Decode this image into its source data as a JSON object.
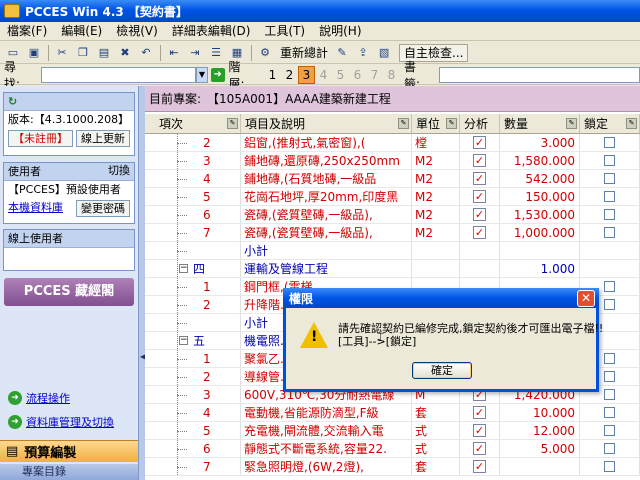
{
  "window": {
    "title": "PCCES Win 4.3 【契約書】"
  },
  "menu": [
    "檔案(F)",
    "編輯(E)",
    "檢視(V)",
    "詳細表編輯(D)",
    "工具(T)",
    "說明(H)"
  ],
  "toolbar": {
    "recalc": "重新總計",
    "selfcheck": "自主檢查..."
  },
  "search": {
    "label": "尋找:",
    "level_label": "階層:",
    "levels": [
      "1",
      "2",
      "3",
      "4",
      "5",
      "6",
      "7",
      "8"
    ],
    "active_level": "3",
    "bookmark_label": "書籤:"
  },
  "left": {
    "version": "版本:【4.3.1000.208】",
    "unregistered": "【未註冊】",
    "online_update": "線上更新",
    "user_header": "使用者",
    "switch": "切換",
    "default_user": "【PCCES】預設使用者",
    "local_db": "本機資料庫",
    "change_pw": "變更密碼",
    "online_users": "線上使用者",
    "banner": "PCCES 藏經閣",
    "nav1": "流程操作",
    "nav2": "資料庫管理及切換",
    "section": "預算編製",
    "section_sub": "專案目錄"
  },
  "project": {
    "label": "目前專案:",
    "code": "【105A001】",
    "name": "AAAA建築新建工程"
  },
  "grid": {
    "headers": {
      "idx": "項次",
      "desc": "項目及說明",
      "unit": "單位",
      "analysis": "分析",
      "qty": "數量",
      "lock": "鎖定"
    },
    "rows": [
      {
        "idx": "2",
        "desc": "鋁窗,(推射式,氣密窗),(",
        "unit": "樘",
        "qty": "3.000",
        "color": "red",
        "ana": true
      },
      {
        "idx": "3",
        "desc": "鋪地磚,還原磚,250x250mm",
        "unit": "M2",
        "qty": "1,580.000",
        "color": "red",
        "ana": true
      },
      {
        "idx": "4",
        "desc": "鋪地磚,(石質地磚,一級品",
        "unit": "M2",
        "qty": "542.000",
        "color": "red",
        "ana": true
      },
      {
        "idx": "5",
        "desc": "花崗石地坪,厚20mm,印度黑",
        "unit": "M2",
        "qty": "150.000",
        "color": "red",
        "ana": true
      },
      {
        "idx": "6",
        "desc": "瓷磚,(瓷質壁磚,一級品),",
        "unit": "M2",
        "qty": "1,530.000",
        "color": "red",
        "ana": true
      },
      {
        "idx": "7",
        "desc": "瓷磚,(瓷質壁磚,一級品),",
        "unit": "M2",
        "qty": "1,000.000",
        "color": "red",
        "ana": true
      },
      {
        "idx": "",
        "desc": "小計",
        "unit": "",
        "qty": "",
        "color": "blue",
        "ana": false
      },
      {
        "idx": "四",
        "desc": "運輸及管線工程",
        "unit": "",
        "qty": "1.000",
        "color": "blue",
        "ana": false,
        "group": true
      },
      {
        "idx": "1",
        "desc": "鋼門框,(電梯...",
        "unit": "",
        "qty": "",
        "color": "red",
        "ana": false
      },
      {
        "idx": "2",
        "desc": "升降階...",
        "unit": "",
        "qty": "",
        "color": "red",
        "ana": false
      },
      {
        "idx": "",
        "desc": "小計",
        "unit": "",
        "qty": "",
        "color": "blue",
        "ana": false
      },
      {
        "idx": "五",
        "desc": "機電照...",
        "unit": "",
        "qty": "",
        "color": "blue",
        "ana": false,
        "group": true
      },
      {
        "idx": "1",
        "desc": "聚氯乙...",
        "unit": "",
        "qty": "",
        "color": "red",
        "ana": false
      },
      {
        "idx": "2",
        "desc": "導線管...",
        "unit": "",
        "qty": "",
        "color": "red",
        "ana": false
      },
      {
        "idx": "3",
        "desc": "600V,310℃,30分耐熱電線",
        "unit": "M",
        "qty": "1,420.000",
        "color": "red",
        "ana": true
      },
      {
        "idx": "4",
        "desc": "電動機,省能源防滴型,F級",
        "unit": "套",
        "qty": "10.000",
        "color": "red",
        "ana": true
      },
      {
        "idx": "5",
        "desc": "充電機,閘流體,交流輸入電",
        "unit": "式",
        "qty": "12.000",
        "color": "red",
        "ana": true
      },
      {
        "idx": "6",
        "desc": "靜態式不斷電系統,容量22.",
        "unit": "式",
        "qty": "5.000",
        "color": "red",
        "ana": true
      },
      {
        "idx": "7",
        "desc": "緊急照明燈,(6W,2燈),",
        "unit": "套",
        "qty": "",
        "color": "red",
        "ana": true
      }
    ]
  },
  "dialog": {
    "title": "權限",
    "line1": "請先確認契約已編修完成,鎖定契約後才可匯出電子檔!!",
    "line2": "[工具]-->[鎖定]",
    "ok": "確定"
  }
}
